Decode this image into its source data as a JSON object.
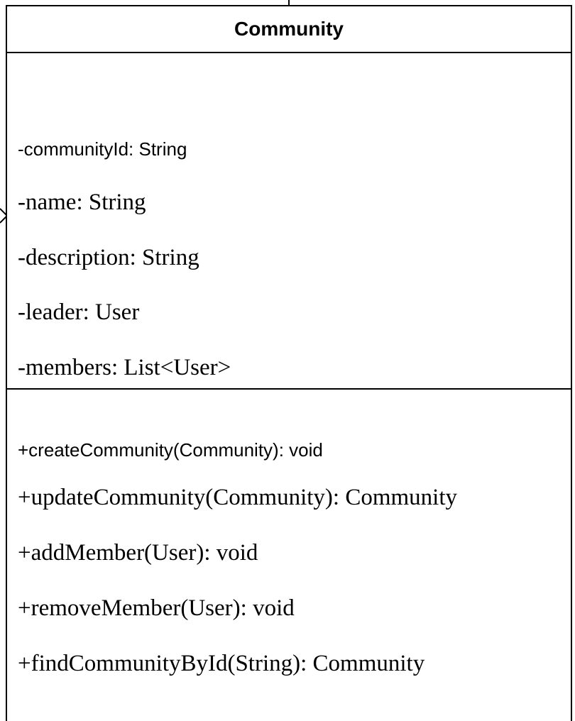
{
  "class": {
    "name": "Community",
    "attributes": [
      "-communityId: String",
      "-name: String",
      "-description: String",
      "-leader: User",
      "-members: List<User>"
    ],
    "operations": [
      "+createCommunity(Community): void",
      "+updateCommunity(Community): Community",
      "+addMember(User): void",
      "+removeMember(User): void",
      "+findCommunityById(String): Community"
    ]
  }
}
